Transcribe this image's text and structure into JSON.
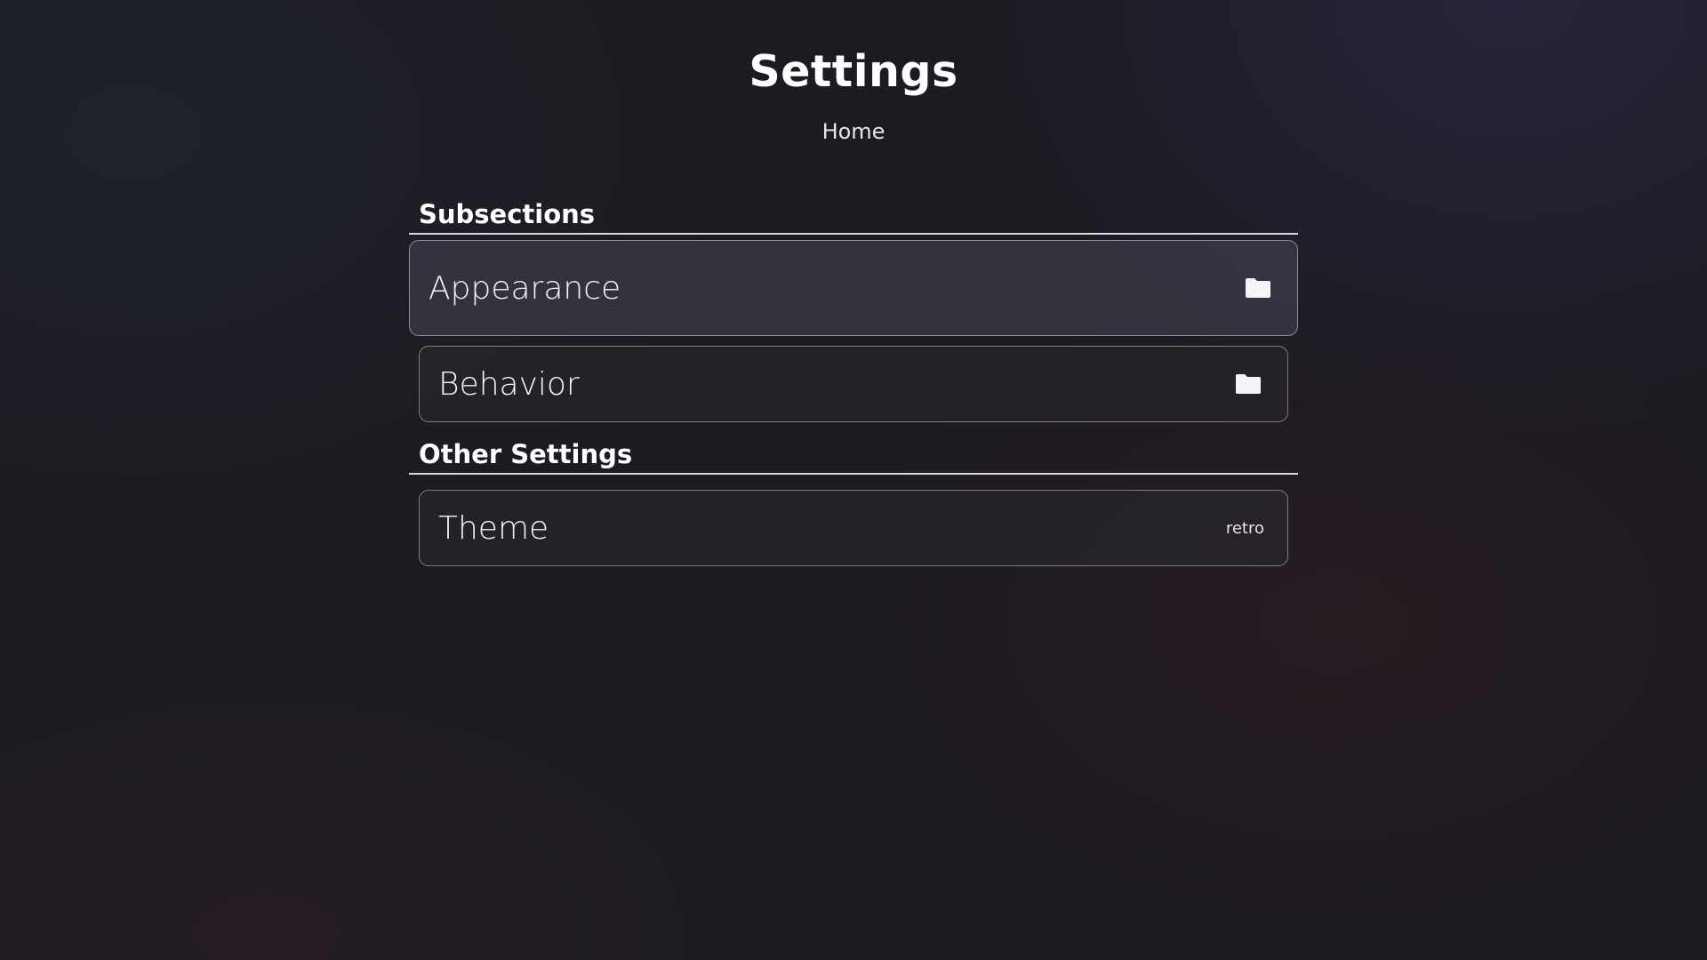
{
  "header": {
    "title": "Settings",
    "breadcrumb": "Home"
  },
  "sections": [
    {
      "title": "Subsections",
      "items": [
        {
          "label": "Appearance",
          "icon": "folder-icon",
          "active": true
        },
        {
          "label": "Behavior",
          "icon": "folder-icon",
          "active": false
        }
      ]
    },
    {
      "title": "Other Settings",
      "items": [
        {
          "label": "Theme",
          "value": "retro"
        }
      ]
    }
  ],
  "colors": {
    "background": "#1c1b21",
    "text": "#f2f2f5",
    "border": "#d8d8de"
  }
}
